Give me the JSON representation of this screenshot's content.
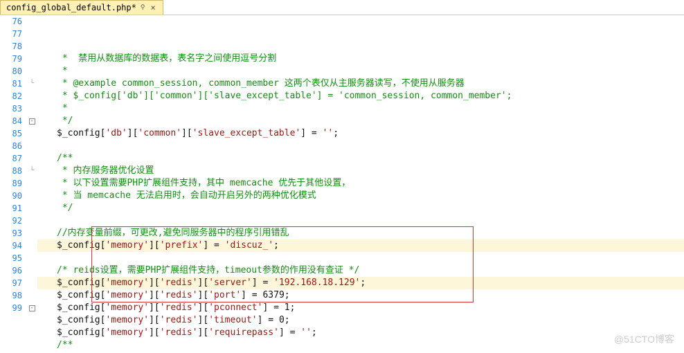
{
  "tab": {
    "name": "config_global_default.php*",
    "pin": "⚲",
    "close": "×"
  },
  "watermark": "@51CTO博客",
  "lines": [
    {
      "n": 76,
      "fold": "",
      "cls": "",
      "tokens": [
        {
          "c": "c-cmt",
          "t": " *  禁用从数据库的数据表，表名字之间使用逗号分割"
        }
      ]
    },
    {
      "n": 77,
      "fold": "",
      "cls": "",
      "tokens": [
        {
          "c": "c-cmt",
          "t": " *"
        }
      ]
    },
    {
      "n": 78,
      "fold": "",
      "cls": "",
      "tokens": [
        {
          "c": "c-cmt",
          "t": " * @example common_session, common_member 这两个表仅从主服务器读写，不使用从服务器"
        }
      ]
    },
    {
      "n": 79,
      "fold": "",
      "cls": "",
      "tokens": [
        {
          "c": "c-cmt",
          "t": " * $_config['db']['common']['slave_except_table'] = 'common_session, common_member';"
        }
      ]
    },
    {
      "n": 80,
      "fold": "",
      "cls": "",
      "tokens": [
        {
          "c": "c-cmt",
          "t": " *"
        }
      ]
    },
    {
      "n": 81,
      "fold": "-",
      "cls": "",
      "tokens": [
        {
          "c": "c-cmt",
          "t": " */"
        }
      ]
    },
    {
      "n": 82,
      "fold": "",
      "cls": "",
      "tokens": [
        {
          "c": "c-var",
          "t": "$_config"
        },
        {
          "c": "c-op",
          "t": "["
        },
        {
          "c": "c-key",
          "t": "'db'"
        },
        {
          "c": "c-op",
          "t": "]["
        },
        {
          "c": "c-key",
          "t": "'common'"
        },
        {
          "c": "c-op",
          "t": "]["
        },
        {
          "c": "c-key",
          "t": "'slave_except_table'"
        },
        {
          "c": "c-op",
          "t": "] = "
        },
        {
          "c": "c-key",
          "t": "''"
        },
        {
          "c": "c-op",
          "t": ";"
        }
      ]
    },
    {
      "n": 83,
      "fold": "",
      "cls": "",
      "tokens": []
    },
    {
      "n": 84,
      "fold": "⊟",
      "cls": "",
      "tokens": [
        {
          "c": "c-cmt",
          "t": "/**"
        }
      ]
    },
    {
      "n": 85,
      "fold": "",
      "cls": "",
      "tokens": [
        {
          "c": "c-cmt",
          "t": " * 内存服务器优化设置"
        }
      ]
    },
    {
      "n": 86,
      "fold": "",
      "cls": "",
      "tokens": [
        {
          "c": "c-cmt",
          "t": " * 以下设置需要PHP扩展组件支持，其中 memcache 优先于其他设置，"
        }
      ]
    },
    {
      "n": 87,
      "fold": "",
      "cls": "",
      "tokens": [
        {
          "c": "c-cmt",
          "t": " * 当 memcache 无法启用时，会自动开启另外的两种优化模式"
        }
      ]
    },
    {
      "n": 88,
      "fold": "-",
      "cls": "",
      "tokens": [
        {
          "c": "c-cmt",
          "t": " */"
        }
      ]
    },
    {
      "n": 89,
      "fold": "",
      "cls": "",
      "tokens": []
    },
    {
      "n": 90,
      "fold": "",
      "cls": "",
      "tokens": [
        {
          "c": "c-cmt",
          "t": "//内存变量前缀，可更改,避免同服务器中的程序引用错乱"
        }
      ]
    },
    {
      "n": 91,
      "fold": "",
      "cls": "cur",
      "tokens": [
        {
          "c": "c-var",
          "t": "$_config"
        },
        {
          "c": "c-op",
          "t": "["
        },
        {
          "c": "c-key",
          "t": "'memory'"
        },
        {
          "c": "c-op",
          "t": "]["
        },
        {
          "c": "c-key",
          "t": "'prefix'"
        },
        {
          "c": "c-op",
          "t": "] = "
        },
        {
          "c": "c-key",
          "t": "'discuz_'"
        },
        {
          "c": "c-op",
          "t": ";"
        }
      ]
    },
    {
      "n": 92,
      "fold": "",
      "cls": "",
      "tokens": []
    },
    {
      "n": 93,
      "fold": "",
      "cls": "",
      "tokens": [
        {
          "c": "c-cmt",
          "t": "/* reids设置，需要PHP扩展组件支持，timeout参数的作用没有查证 */"
        }
      ]
    },
    {
      "n": 94,
      "fold": "",
      "cls": "cur",
      "tokens": [
        {
          "c": "c-var",
          "t": "$_config"
        },
        {
          "c": "c-op",
          "t": "["
        },
        {
          "c": "c-key",
          "t": "'memory'"
        },
        {
          "c": "c-op",
          "t": "]["
        },
        {
          "c": "c-key",
          "t": "'redis'"
        },
        {
          "c": "c-op",
          "t": "]["
        },
        {
          "c": "c-key",
          "t": "'server'"
        },
        {
          "c": "c-op",
          "t": "] = "
        },
        {
          "c": "c-key",
          "t": "'192.168.18.129'"
        },
        {
          "c": "c-op",
          "t": ";"
        }
      ]
    },
    {
      "n": 95,
      "fold": "",
      "cls": "",
      "tokens": [
        {
          "c": "c-var",
          "t": "$_config"
        },
        {
          "c": "c-op",
          "t": "["
        },
        {
          "c": "c-key",
          "t": "'memory'"
        },
        {
          "c": "c-op",
          "t": "]["
        },
        {
          "c": "c-key",
          "t": "'redis'"
        },
        {
          "c": "c-op",
          "t": "]["
        },
        {
          "c": "c-key",
          "t": "'port'"
        },
        {
          "c": "c-op",
          "t": "] = "
        },
        {
          "c": "c-num",
          "t": "6379"
        },
        {
          "c": "c-op",
          "t": ";"
        }
      ]
    },
    {
      "n": 96,
      "fold": "",
      "cls": "",
      "tokens": [
        {
          "c": "c-var",
          "t": "$_config"
        },
        {
          "c": "c-op",
          "t": "["
        },
        {
          "c": "c-key",
          "t": "'memory'"
        },
        {
          "c": "c-op",
          "t": "]["
        },
        {
          "c": "c-key",
          "t": "'redis'"
        },
        {
          "c": "c-op",
          "t": "]["
        },
        {
          "c": "c-key",
          "t": "'pconnect'"
        },
        {
          "c": "c-op",
          "t": "] = "
        },
        {
          "c": "c-num",
          "t": "1"
        },
        {
          "c": "c-op",
          "t": ";"
        }
      ]
    },
    {
      "n": 97,
      "fold": "",
      "cls": "",
      "tokens": [
        {
          "c": "c-var",
          "t": "$_config"
        },
        {
          "c": "c-op",
          "t": "["
        },
        {
          "c": "c-key",
          "t": "'memory'"
        },
        {
          "c": "c-op",
          "t": "]["
        },
        {
          "c": "c-key",
          "t": "'redis'"
        },
        {
          "c": "c-op",
          "t": "]["
        },
        {
          "c": "c-key",
          "t": "'timeout'"
        },
        {
          "c": "c-op",
          "t": "] = "
        },
        {
          "c": "c-num",
          "t": "0"
        },
        {
          "c": "c-op",
          "t": ";"
        }
      ]
    },
    {
      "n": 98,
      "fold": "",
      "cls": "",
      "tokens": [
        {
          "c": "c-var",
          "t": "$_config"
        },
        {
          "c": "c-op",
          "t": "["
        },
        {
          "c": "c-key",
          "t": "'memory'"
        },
        {
          "c": "c-op",
          "t": "]["
        },
        {
          "c": "c-key",
          "t": "'redis'"
        },
        {
          "c": "c-op",
          "t": "]["
        },
        {
          "c": "c-key",
          "t": "'requirepass'"
        },
        {
          "c": "c-op",
          "t": "] = "
        },
        {
          "c": "c-key",
          "t": "''"
        },
        {
          "c": "c-op",
          "t": ";"
        }
      ]
    },
    {
      "n": 99,
      "fold": "⊟",
      "cls": "",
      "tokens": [
        {
          "c": "c-cmt",
          "t": "/**"
        }
      ]
    }
  ],
  "redbox": {
    "startLine": 93,
    "endLine": 98
  }
}
